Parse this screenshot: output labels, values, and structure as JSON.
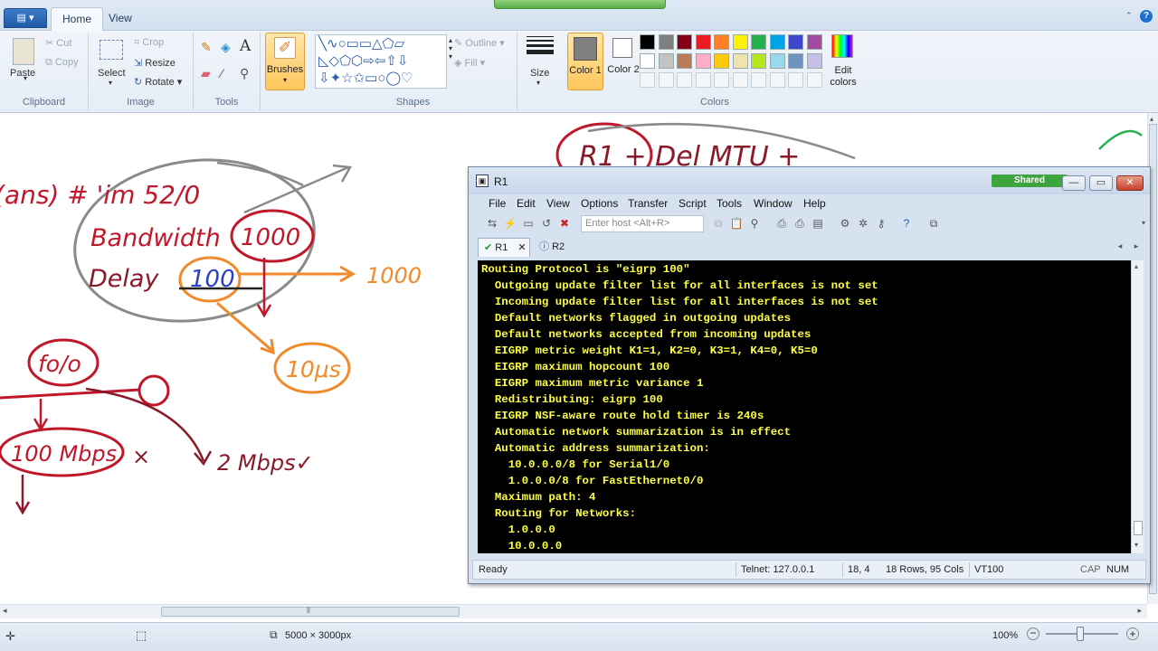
{
  "paint": {
    "tabs": [
      "Home",
      "View"
    ],
    "app_menu_icon": "paint-menu-icon",
    "clipboard": {
      "paste": "Paste",
      "cut": "Cut",
      "copy": "Copy",
      "label": "Clipboard"
    },
    "image": {
      "select": "Select",
      "crop": "Crop",
      "resize": "Resize",
      "rotate": "Rotate",
      "label": "Image"
    },
    "tools": {
      "label": "Tools",
      "text_tool": "A"
    },
    "brushes": {
      "label": "Brushes"
    },
    "shapes": {
      "outline": "Outline",
      "fill": "Fill",
      "label": "Shapes"
    },
    "size": {
      "label": "Size"
    },
    "colors": {
      "color1": "Color 1",
      "color2": "Color 2",
      "edit": "Edit colors",
      "label": "Colors",
      "palette_row1": [
        "#000000",
        "#7f7f7f",
        "#880015",
        "#ed1c24",
        "#ff7f27",
        "#fff200",
        "#22b14c",
        "#00a2e8",
        "#3f48cc",
        "#a349a4"
      ],
      "palette_row2": [
        "#ffffff",
        "#c3c3c3",
        "#b97a57",
        "#ffaec9",
        "#ffc90e",
        "#efe4b0",
        "#b5e61d",
        "#99d9ea",
        "#7092be",
        "#c8bfe7"
      ],
      "color1_value": "#7f7f7f"
    },
    "status": {
      "dimensions": "5000 × 3000px",
      "zoom": "100%"
    }
  },
  "sketch": {
    "left_top": "(ans) # 'im 52/0",
    "bandwidth": "Bandwidth",
    "bw_value": "1000",
    "delay": "Delay",
    "delay_value": "100",
    "arrow_1000": "1000",
    "delay_us": "10μs",
    "fofo": "fo/o",
    "speed_100": "100 Mbps",
    "x_mark": "×",
    "speed_2": "2 Mbps✓",
    "top_partial": "R1   +  Del       MTU   +",
    "colors": {
      "red": "#c0182a",
      "orange": "#f08a2a",
      "gray": "#888888",
      "blue": "#2c3fc4"
    }
  },
  "crt": {
    "title": "R1",
    "shared": "Shared",
    "menu": [
      "File",
      "Edit",
      "View",
      "Options",
      "Transfer",
      "Script",
      "Tools",
      "Window",
      "Help"
    ],
    "host_placeholder": "Enter host <Alt+R>",
    "sessions": [
      "R1",
      "R2"
    ],
    "terminal_lines": [
      "Routing Protocol is \"eigrp 100\"",
      "  Outgoing update filter list for all interfaces is not set",
      "  Incoming update filter list for all interfaces is not set",
      "  Default networks flagged in outgoing updates",
      "  Default networks accepted from incoming updates",
      "  EIGRP metric weight K1=1, K2=0, K3=1, K4=0, K5=0",
      "  EIGRP maximum hopcount 100",
      "  EIGRP maximum metric variance 1",
      "  Redistributing: eigrp 100",
      "  EIGRP NSF-aware route hold timer is 240s",
      "  Automatic network summarization is in effect",
      "  Automatic address summarization:",
      "    10.0.0.0/8 for Serial1/0",
      "    1.0.0.0/8 for FastEthernet0/0",
      "  Maximum path: 4",
      "  Routing for Networks:",
      "    1.0.0.0",
      "    10.0.0.0"
    ],
    "status": {
      "ready": "Ready",
      "telnet": "Telnet: 127.0.0.1",
      "cursor": "18,  4",
      "size": "18 Rows, 95 Cols",
      "term": "VT100",
      "cap": "CAP",
      "num": "NUM"
    }
  }
}
